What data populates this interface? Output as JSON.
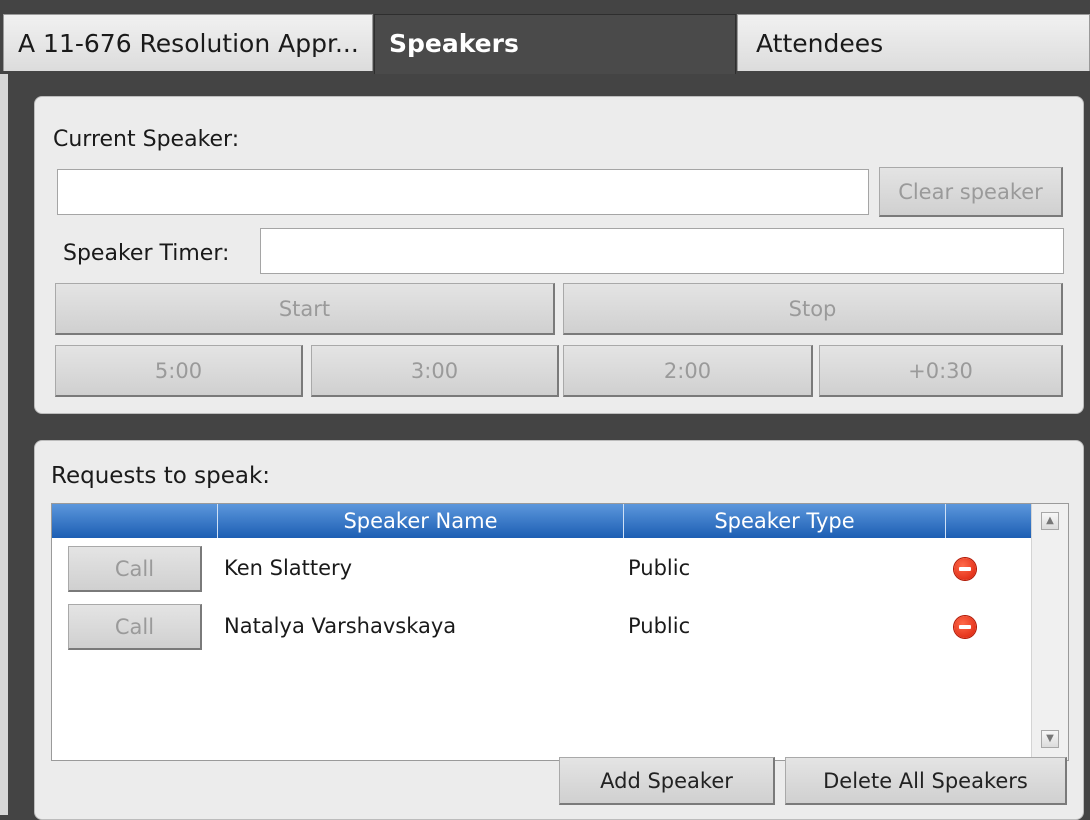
{
  "tabs": [
    {
      "label": "A 11-676 Resolution Appr..."
    },
    {
      "label": "Speakers"
    },
    {
      "label": "Attendees"
    }
  ],
  "current_speaker": {
    "label": "Current Speaker:",
    "value": "",
    "clear_label": "Clear speaker"
  },
  "timer": {
    "label": "Speaker Timer:",
    "value": "",
    "start_label": "Start",
    "stop_label": "Stop",
    "presets": [
      "5:00",
      "3:00",
      "2:00",
      "+0:30"
    ]
  },
  "requests": {
    "label": "Requests to speak:",
    "columns": [
      "",
      "Speaker Name",
      "Speaker Type",
      ""
    ],
    "rows": [
      {
        "call_label": "Call",
        "name": "Ken Slattery",
        "type": "Public"
      },
      {
        "call_label": "Call",
        "name": "Natalya Varshavskaya",
        "type": "Public"
      }
    ],
    "add_label": "Add Speaker",
    "delete_all_label": "Delete All Speakers"
  },
  "icons": {
    "remove": "remove-circle-icon",
    "scroll_up": "arrow-up-icon",
    "scroll_down": "arrow-down-icon"
  },
  "colors": {
    "header_blue": "#2f6fc2",
    "remove_red": "#e0250d",
    "background_dark": "#444444",
    "panel": "#ececec"
  }
}
